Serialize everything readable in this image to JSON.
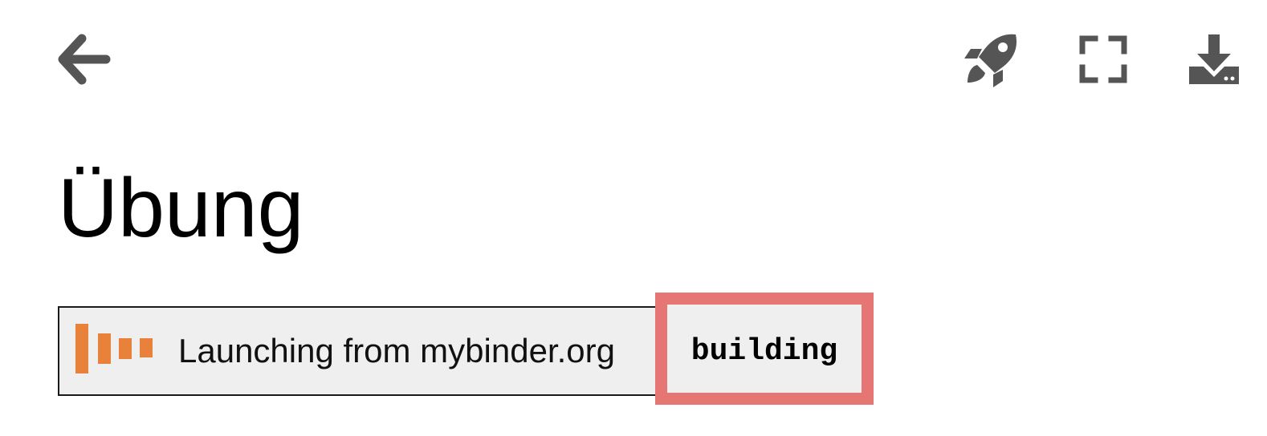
{
  "toolbar": {
    "back_icon": "arrow-left-icon",
    "launch_icon": "rocket-icon",
    "fullscreen_icon": "fullscreen-icon",
    "download_icon": "download-icon",
    "icon_color": "#555555"
  },
  "page": {
    "title": "Übung"
  },
  "binder": {
    "launch_text": "Launching from mybinder.org",
    "status": "building",
    "logo_color": "#e8813a",
    "highlight_color": "#e57673"
  }
}
